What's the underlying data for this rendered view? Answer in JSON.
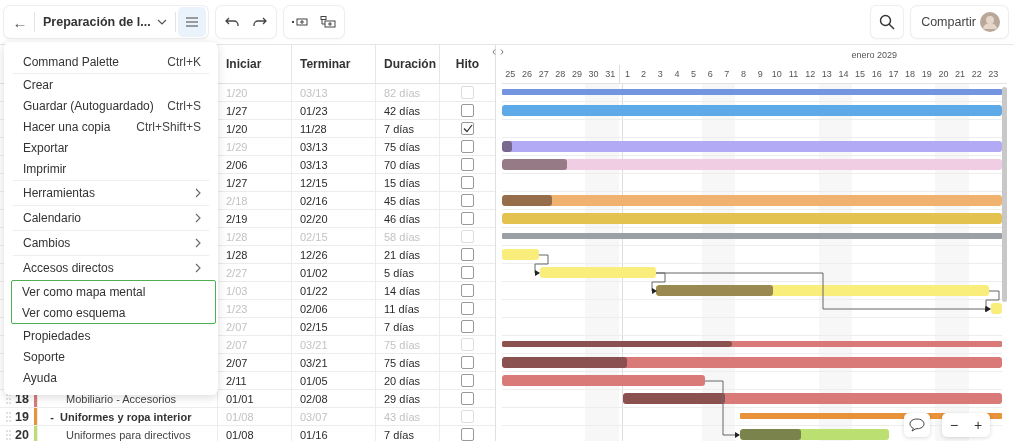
{
  "toolbar": {
    "back": "←",
    "title": "Preparación de l...",
    "share": "Compartir"
  },
  "menu": {
    "groups": [
      {
        "highlighted": false,
        "items": [
          {
            "kind": "item",
            "label": "Command Palette",
            "shortcut": "Ctrl+K"
          }
        ]
      },
      {
        "highlighted": false,
        "items": [
          {
            "kind": "item",
            "label": "Crear"
          },
          {
            "kind": "item",
            "label": "Guardar (Autoguardado)",
            "shortcut": "Ctrl+S"
          },
          {
            "kind": "item",
            "label": "Hacer una copia",
            "shortcut": "Ctrl+Shift+S"
          },
          {
            "kind": "item",
            "label": "Exportar"
          },
          {
            "kind": "item",
            "label": "Imprimir"
          }
        ]
      },
      {
        "highlighted": false,
        "items": [
          {
            "kind": "submenu",
            "label": "Herramientas"
          }
        ]
      },
      {
        "highlighted": false,
        "items": [
          {
            "kind": "submenu",
            "label": "Calendario"
          }
        ]
      },
      {
        "highlighted": false,
        "items": [
          {
            "kind": "submenu",
            "label": "Cambios"
          }
        ]
      },
      {
        "highlighted": false,
        "items": [
          {
            "kind": "submenu",
            "label": "Accesos directos"
          }
        ]
      },
      {
        "highlighted": true,
        "items": [
          {
            "kind": "item",
            "label": "Ver como mapa mental"
          },
          {
            "kind": "item",
            "label": "Ver como esquema"
          }
        ]
      },
      {
        "highlighted": false,
        "items": [
          {
            "kind": "item",
            "label": "Propiedades"
          },
          {
            "kind": "item",
            "label": "Soporte"
          },
          {
            "kind": "item",
            "label": "Ayuda"
          }
        ]
      }
    ]
  },
  "table": {
    "columns": [
      "Iniciar",
      "Terminar",
      "Duración",
      "Hito"
    ],
    "rows": [
      {
        "start": "1/20",
        "end": "03/13",
        "duration": "82 días",
        "milestone": false,
        "summary": true,
        "start_auto": true,
        "color": "#7496e0"
      },
      {
        "start": "1/27",
        "end": "01/23",
        "duration": "42 días",
        "milestone": false,
        "summary": false,
        "start_auto": false,
        "color": "#5eaae8"
      },
      {
        "start": "1/20",
        "end": "11/28",
        "duration": "7 días",
        "milestone": true,
        "summary": false,
        "start_auto": false
      },
      {
        "start": "1/29",
        "end": "03/13",
        "duration": "75 días",
        "milestone": false,
        "summary": false,
        "start_auto": true,
        "color": "#b3aaf5",
        "level": 0.02
      },
      {
        "start": "2/06",
        "end": "03/13",
        "duration": "70 días",
        "milestone": false,
        "summary": false,
        "start_auto": false,
        "color": "#f0cde3",
        "level": 0.13
      },
      {
        "start": "1/27",
        "end": "12/15",
        "duration": "15 días",
        "milestone": false,
        "summary": false,
        "start_auto": false
      },
      {
        "start": "2/18",
        "end": "02/16",
        "duration": "45 días",
        "milestone": false,
        "summary": false,
        "start_auto": true,
        "color": "#f0b36f",
        "level": 0.1
      },
      {
        "start": "2/19",
        "end": "02/20",
        "duration": "46 días",
        "milestone": false,
        "summary": false,
        "start_auto": false,
        "color": "#e3c24f"
      },
      {
        "start": "1/28",
        "end": "02/15",
        "duration": "58 días",
        "milestone": false,
        "summary": true,
        "start_auto": true,
        "color": "#9aa0a6"
      },
      {
        "start": "1/28",
        "end": "12/26",
        "duration": "21 días",
        "milestone": false,
        "summary": false,
        "start_auto": false,
        "color": "#f9ed7c"
      },
      {
        "start": "2/27",
        "end": "01/02",
        "duration": "5 días",
        "milestone": false,
        "summary": false,
        "start_auto": true,
        "color": "#f9ed7c"
      },
      {
        "start": "1/03",
        "end": "01/22",
        "duration": "14 días",
        "milestone": false,
        "summary": false,
        "start_auto": true,
        "color": "#f9ed7c",
        "level": 0.35
      },
      {
        "start": "1/23",
        "end": "02/06",
        "duration": "11 días",
        "milestone": false,
        "summary": false,
        "start_auto": true,
        "color": "#f9ed7c"
      },
      {
        "start": "2/07",
        "end": "02/15",
        "duration": "7 días",
        "milestone": false,
        "summary": false,
        "start_auto": true
      },
      {
        "start": "2/07",
        "end": "03/21",
        "duration": "75 días",
        "milestone": false,
        "summary": true,
        "start_auto": true,
        "color": "#d97a78",
        "level": 0.46
      },
      {
        "start": "2/07",
        "end": "03/21",
        "duration": "75 días",
        "milestone": false,
        "summary": false,
        "start_auto": false,
        "color": "#d97a78",
        "level": 0.25
      },
      {
        "start": "2/11",
        "end": "01/05",
        "duration": "20 días",
        "milestone": false,
        "summary": false,
        "start_auto": false,
        "color": "#d97a78"
      },
      {
        "num": "18",
        "name": "Mobiliario - Accesorios",
        "start": "01/01",
        "end": "02/08",
        "duration": "29 días",
        "milestone": false,
        "summary": false,
        "start_auto": false,
        "color": "#d97a78",
        "level": 0.27
      },
      {
        "num": "19",
        "name": "Uniformes y ropa interior",
        "toggle": "-",
        "expanded": true,
        "start": "01/08",
        "end": "03/07",
        "duration": "43 días",
        "milestone": false,
        "summary": true,
        "start_auto": true,
        "color": "#e8923a"
      },
      {
        "num": "20",
        "name": "Uniformes para directivos",
        "start": "01/08",
        "end": "01/16",
        "duration": "7 días",
        "milestone": false,
        "summary": false,
        "start_auto": false,
        "color": "#bbdf70",
        "level": 0.41
      }
    ]
  },
  "gantt": {
    "month": "enero 2029",
    "days": [
      "25",
      "26",
      "27",
      "28",
      "29",
      "30",
      "31",
      "1",
      "2",
      "3",
      "4",
      "5",
      "6",
      "7",
      "8",
      "9",
      "10",
      "11",
      "12",
      "13",
      "14",
      "15",
      "16",
      "17",
      "18",
      "19",
      "20",
      "21",
      "22",
      "23"
    ],
    "zoom_out": "−",
    "zoom_in": "+"
  }
}
